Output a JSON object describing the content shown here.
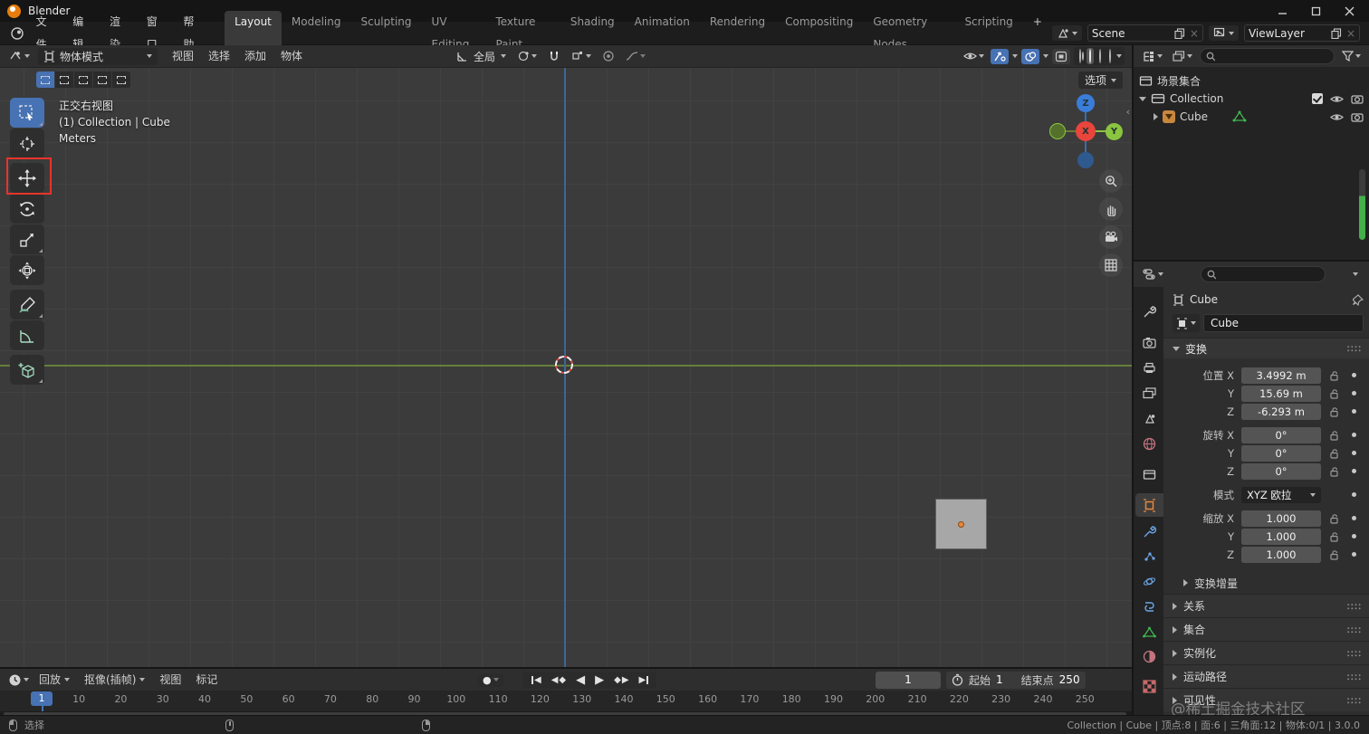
{
  "window": {
    "title": "Blender"
  },
  "topbar": {
    "menus": [
      "文件",
      "编辑",
      "渲染",
      "窗口",
      "帮助"
    ],
    "workspaces": [
      "Layout",
      "Modeling",
      "Sculpting",
      "UV Editing",
      "Texture Paint",
      "Shading",
      "Animation",
      "Rendering",
      "Compositing",
      "Geometry Nodes",
      "Scripting"
    ],
    "new_workspace_label": "+",
    "scene_value": "Scene",
    "viewlayer_value": "ViewLayer"
  },
  "viewport": {
    "header": {
      "mode": "物体模式",
      "menus": [
        "视图",
        "选择",
        "添加",
        "物体"
      ],
      "orientation": "全局",
      "options": "选项"
    },
    "overlay_lines": [
      "正交右视图",
      "(1) Collection | Cube",
      "Meters"
    ],
    "gizmo": {
      "z": "Z",
      "x": "X",
      "y": "Y"
    }
  },
  "outliner": {
    "scene_collection": "场景集合",
    "collection": "Collection",
    "object": "Cube"
  },
  "properties": {
    "breadcrumb": "Cube",
    "name_value": "Cube",
    "transform": {
      "title": "变换",
      "location_rows": [
        {
          "label": "位置 X",
          "value": "3.4992 m"
        },
        {
          "label": "Y",
          "value": "15.69 m"
        },
        {
          "label": "Z",
          "value": "-6.293 m"
        }
      ],
      "rotation_rows": [
        {
          "label": "旋转 X",
          "value": "0°"
        },
        {
          "label": "Y",
          "value": "0°"
        },
        {
          "label": "Z",
          "value": "0°"
        }
      ],
      "mode_label": "模式",
      "mode_value": "XYZ 欧拉",
      "scale_rows": [
        {
          "label": "缩放 X",
          "value": "1.000"
        },
        {
          "label": "Y",
          "value": "1.000"
        },
        {
          "label": "Z",
          "value": "1.000"
        }
      ],
      "subpanel": "变换增量"
    },
    "collapsed_panels": [
      "关系",
      "集合",
      "实例化",
      "运动路径",
      "可见性"
    ],
    "watermark": "@稀土掘金技术社区"
  },
  "timeline": {
    "menus": [
      "回放",
      "抠像(插帧)",
      "视图",
      "标记"
    ],
    "current_frame": "1",
    "start_label": "起始",
    "start_value": "1",
    "end_label": "结束点",
    "end_value": "250",
    "playhead": "1",
    "ticks": [
      "10",
      "20",
      "30",
      "40",
      "50",
      "60",
      "70",
      "80",
      "90",
      "100",
      "110",
      "120",
      "130",
      "140",
      "150",
      "160",
      "170",
      "180",
      "190",
      "200",
      "210",
      "220",
      "230",
      "240",
      "250"
    ]
  },
  "statusbar": {
    "select_label": "选择",
    "info": "Collection | Cube | 顶点:8 | 面:6 | 三角面:12 | 物体:0/1 | 3.0.0"
  },
  "icons": {
    "play": "▶",
    "play_reverse": "◀",
    "key_diamond": "◆",
    "record_dot": "●",
    "collapse_left": "‹"
  },
  "colors": {
    "accent": "#4772b3",
    "axis_y_green": "#66803a",
    "axis_z_blue": "#3f6596",
    "object_orange": "#e8883c",
    "annotation_red": "#e8342c"
  }
}
